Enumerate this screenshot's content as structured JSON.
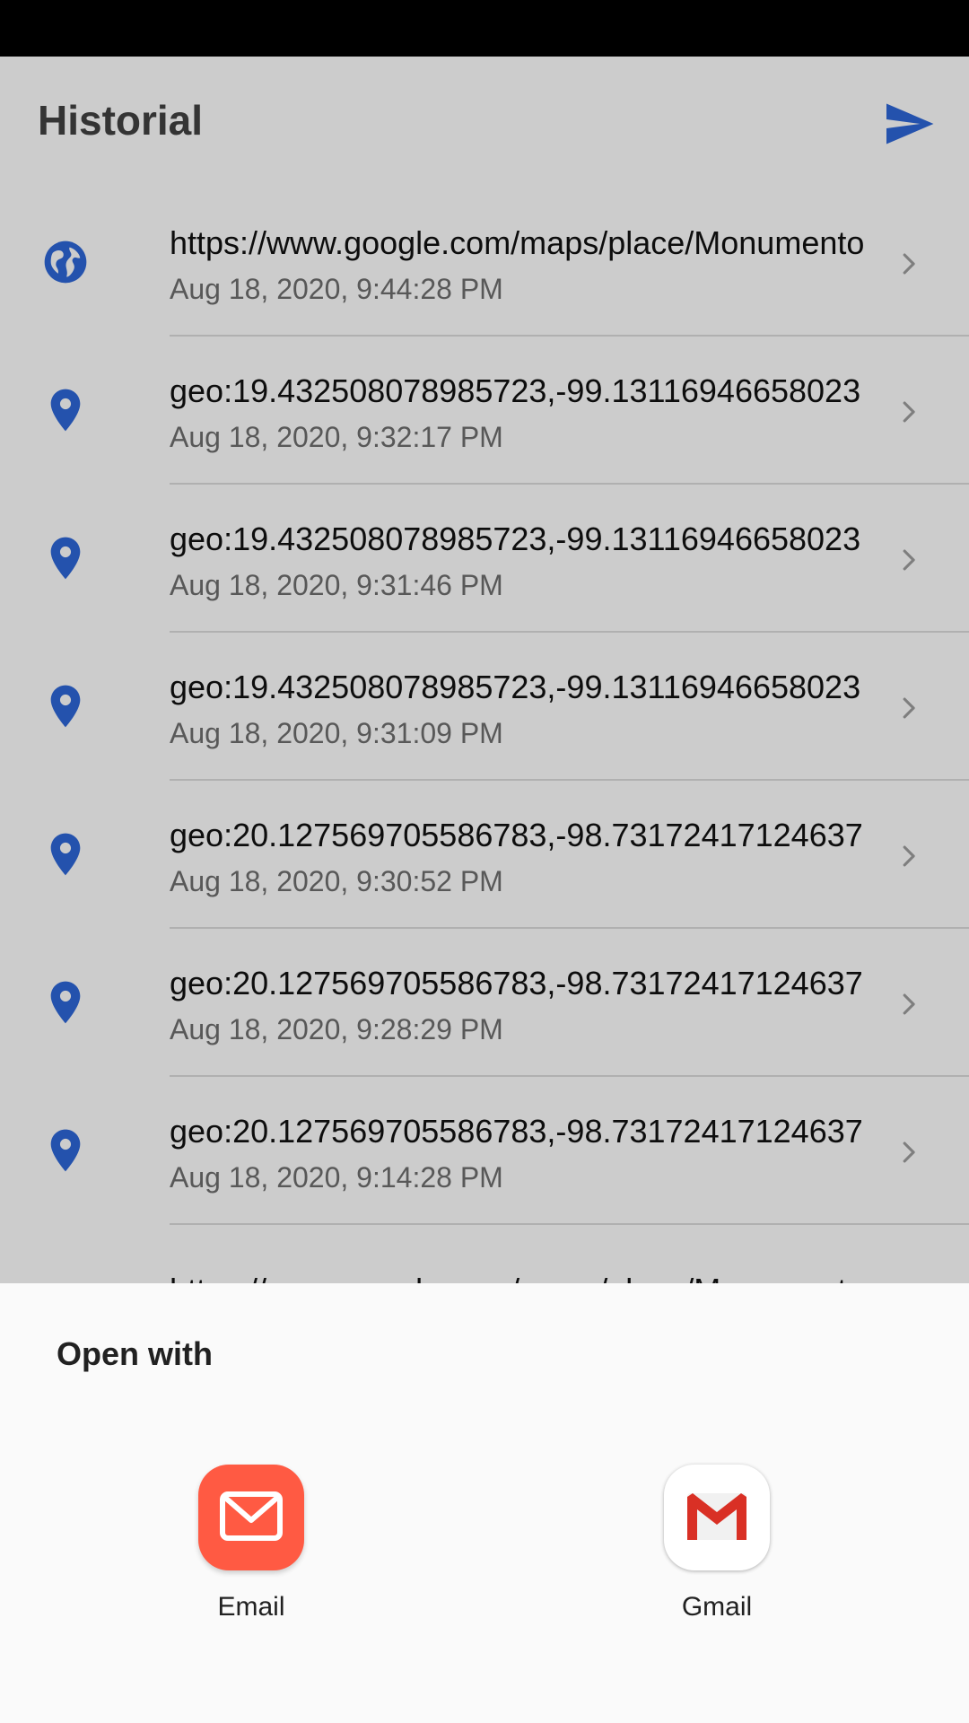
{
  "header": {
    "title": "Historial",
    "send_icon": "send-icon",
    "accent_color": "#2d67d9"
  },
  "history": [
    {
      "type": "globe",
      "icon": "globe-icon",
      "title": "https://www.google.com/maps/place/Monumento",
      "date": "Aug 18, 2020, 9:44:28 PM"
    },
    {
      "type": "pin",
      "icon": "location-pin-icon",
      "title": "geo:19.432508078985723,-99.13116946658023",
      "date": "Aug 18, 2020, 9:32:17 PM"
    },
    {
      "type": "pin",
      "icon": "location-pin-icon",
      "title": "geo:19.432508078985723,-99.13116946658023",
      "date": "Aug 18, 2020, 9:31:46 PM"
    },
    {
      "type": "pin",
      "icon": "location-pin-icon",
      "title": "geo:19.432508078985723,-99.13116946658023",
      "date": "Aug 18, 2020, 9:31:09 PM"
    },
    {
      "type": "pin",
      "icon": "location-pin-icon",
      "title": "geo:20.127569705586783,-98.73172417124637",
      "date": "Aug 18, 2020, 9:30:52 PM"
    },
    {
      "type": "pin",
      "icon": "location-pin-icon",
      "title": "geo:20.127569705586783,-98.73172417124637",
      "date": "Aug 18, 2020, 9:28:29 PM"
    },
    {
      "type": "pin",
      "icon": "location-pin-icon",
      "title": "geo:20.127569705586783,-98.73172417124637",
      "date": "Aug 18, 2020, 9:14:28 PM"
    },
    {
      "type": "globe",
      "icon": "globe-icon",
      "title": "https://www.google.com/maps/place/Monumento",
      "date": ""
    }
  ],
  "sheet": {
    "title": "Open with",
    "apps": [
      {
        "label": "Email",
        "icon": "email-app-icon",
        "color": "#ff5a43"
      },
      {
        "label": "Gmail",
        "icon": "gmail-app-icon",
        "color": "#d93025"
      }
    ]
  }
}
